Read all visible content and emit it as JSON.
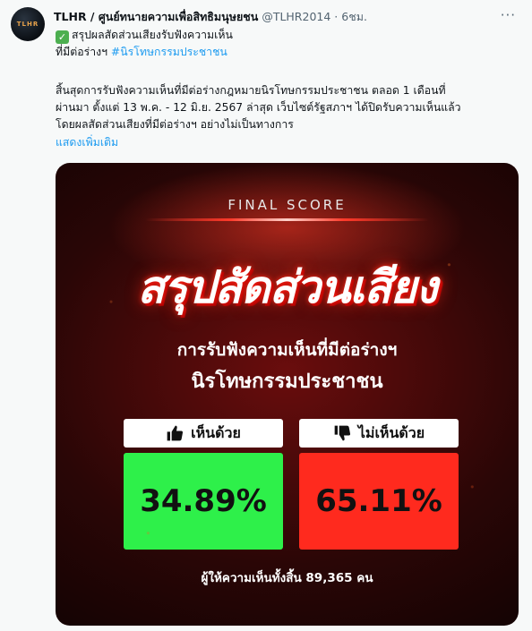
{
  "account": {
    "avatar_text": "TLHR",
    "name": "TLHR / ศูนย์ทนายความเพื่อสิทธิมนุษยชน",
    "handle": "@TLHR2014",
    "separator": "·",
    "time": "6ชม.",
    "more_icon": "more-horizontal-icon"
  },
  "tweet": {
    "line1_text": "สรุปผลสัดส่วนเสียงรับฟังความเห็น",
    "line2_prefix": "ที่มีต่อร่างฯ ",
    "hashtag": "#นิรโทษกรรมประชาชน",
    "body_line1": "สิ้นสุดการรับฟังความเห็นที่มีต่อร่างกฎหมายนิรโทษกรรมประชาชน ตลอด 1 เดือนที่",
    "body_line2": "ผ่านมา ตั้งแต่ 13 พ.ค. - 12 มิ.ย. 2567 ล่าสุด เว็บไซต์รัฐสภาฯ ได้ปิดรับความเห็นแล้ว",
    "body_line3": "โดยผลสัดส่วนเสียงที่มีต่อร่างฯ อย่างไม่เป็นทางการ",
    "show_more": "แสดงเพิ่มเติม"
  },
  "card": {
    "final_score": "FINAL SCORE",
    "title": "สรุปสัดส่วนเสียง",
    "subtitle1": "การรับฟังความเห็นที่มีต่อร่างฯ",
    "subtitle2": "นิรโทษกรรมประชาชน",
    "agree_label": "เห็นด้วย",
    "agree_value": "34.89%",
    "disagree_label": "ไม่เห็นด้วย",
    "disagree_value": "65.11%",
    "total": "ผู้ให้ความเห็นทั้งสิ้น 89,365 คน",
    "colors": {
      "agree": "#2ef04a",
      "disagree": "#ff2a1e",
      "background": "#6a0d0d"
    },
    "icons": {
      "agree": "thumbs-up-icon",
      "disagree": "thumbs-down-icon"
    }
  }
}
